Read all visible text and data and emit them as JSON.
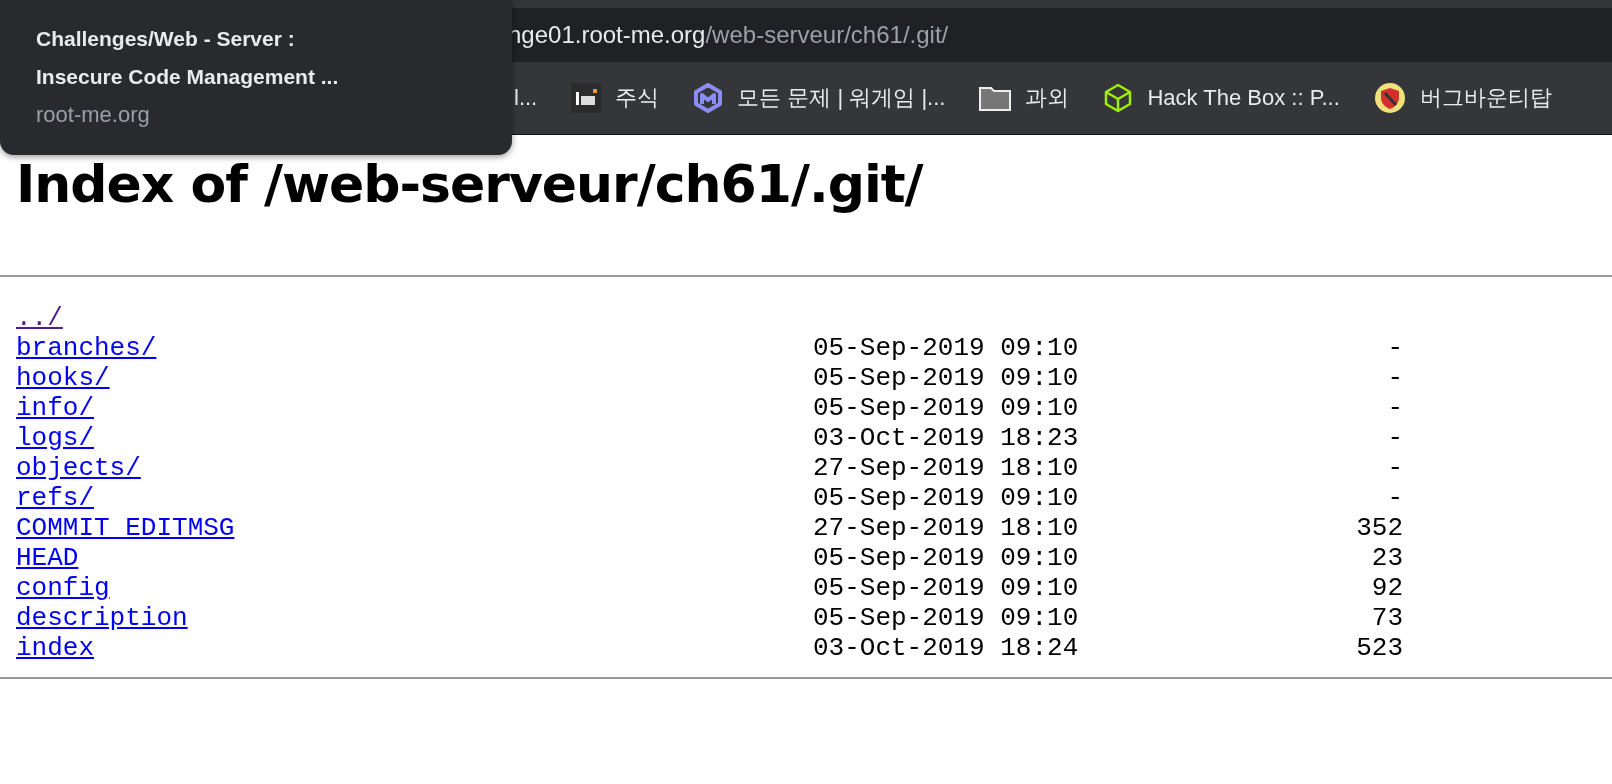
{
  "tooltip": {
    "title_lines": [
      "Challenges/Web - Server :",
      "Insecure Code Management ..."
    ],
    "domain": "root-me.org"
  },
  "address_bar": {
    "host": "nge01.root-me.org",
    "path": "/web-serveur/ch61/.git/"
  },
  "bookmarks": [
    {
      "kind": "plain",
      "label": "l..."
    },
    {
      "kind": "inv",
      "label": "주식"
    },
    {
      "kind": "hexagon",
      "label": "모든 문제 | 워게임 |..."
    },
    {
      "kind": "folder",
      "label": "과외"
    },
    {
      "kind": "cube",
      "label": "Hack The Box :: P..."
    },
    {
      "kind": "shield",
      "label": "버그바운티탑"
    }
  ],
  "page": {
    "heading": "Index of /web-serveur/ch61/.git/",
    "entries": [
      {
        "name": "../",
        "visited": true
      },
      {
        "name": "branches/",
        "visited": false,
        "date": "05-Sep-2019 09:10",
        "size": "-"
      },
      {
        "name": "hooks/",
        "visited": false,
        "date": "05-Sep-2019 09:10",
        "size": "-"
      },
      {
        "name": "info/",
        "visited": false,
        "date": "05-Sep-2019 09:10",
        "size": "-"
      },
      {
        "name": "logs/",
        "visited": false,
        "date": "03-Oct-2019 18:23",
        "size": "-"
      },
      {
        "name": "objects/",
        "visited": false,
        "date": "27-Sep-2019 18:10",
        "size": "-"
      },
      {
        "name": "refs/",
        "visited": false,
        "date": "05-Sep-2019 09:10",
        "size": "-"
      },
      {
        "name": "COMMIT_EDITMSG",
        "visited": false,
        "date": "27-Sep-2019 18:10",
        "size": "352"
      },
      {
        "name": "HEAD",
        "visited": false,
        "date": "05-Sep-2019 09:10",
        "size": "23"
      },
      {
        "name": "config",
        "visited": false,
        "date": "05-Sep-2019 09:10",
        "size": "92"
      },
      {
        "name": "description",
        "visited": false,
        "date": "05-Sep-2019 09:10",
        "size": "73"
      },
      {
        "name": "index",
        "visited": false,
        "date": "03-Oct-2019 18:24",
        "size": "523"
      }
    ]
  }
}
